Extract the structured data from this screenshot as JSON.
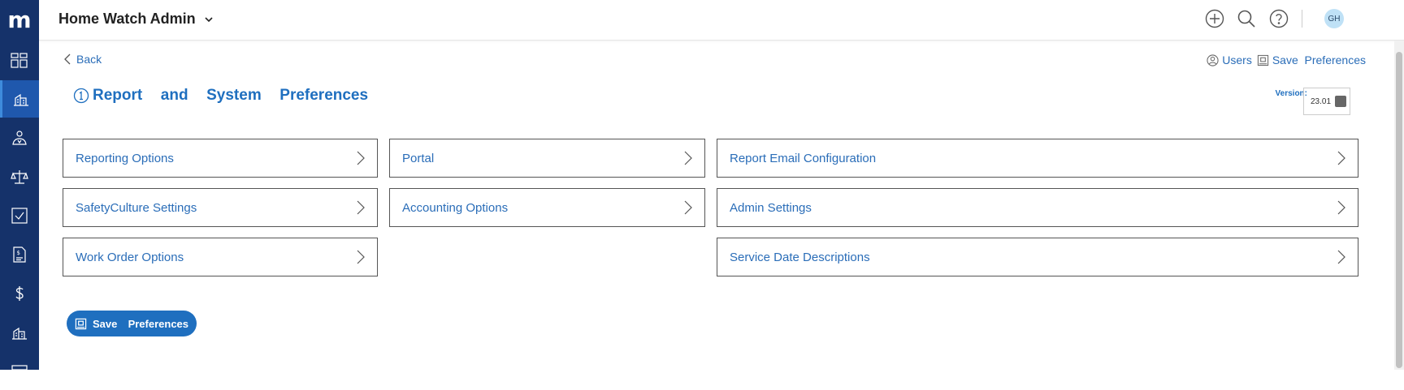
{
  "app": {
    "title": "Home Watch Admin",
    "logo": "m"
  },
  "header": {
    "avatar_initials": "GH"
  },
  "nav": {
    "back_label": "Back",
    "users_label": "Users",
    "save_label": "Save  Preferences"
  },
  "page": {
    "title": "Report  and  System  Preferences",
    "version_label": "Version:",
    "version_value": "23.01"
  },
  "cards": {
    "reporting_options": "Reporting Options",
    "portal": "Portal",
    "report_email_configuration": "Report Email Configuration",
    "safetyculture_settings": "SafetyCulture Settings",
    "accounting_options": "Accounting Options",
    "admin_settings": "Admin Settings",
    "work_order_options": "Work Order Options",
    "service_date_descriptions": "Service Date Descriptions"
  },
  "footer": {
    "save_button_label": "Save  Preferences"
  },
  "icons": {
    "sidebar": [
      "dashboard-icon",
      "property-icon",
      "inspector-icon",
      "scale-icon",
      "checklist-icon",
      "invoice-icon",
      "dollar-icon",
      "building-icon",
      "calendar-icon"
    ],
    "top": [
      "add-icon",
      "search-icon",
      "help-icon"
    ]
  },
  "colors": {
    "sidebar": "#15326a",
    "sidebar_active": "#1f58ad",
    "accent": "#1f6fbf",
    "link": "#2a6db8"
  }
}
